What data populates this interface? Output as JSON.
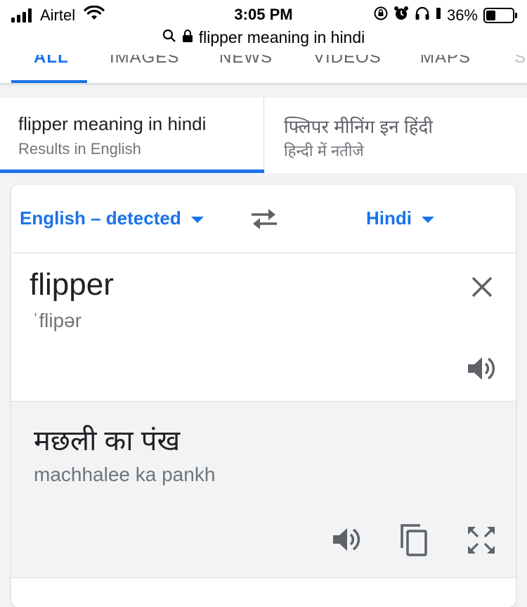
{
  "status_bar": {
    "carrier": "Airtel",
    "time": "3:05 PM",
    "battery_percent": "36%",
    "battery_level": 0.36
  },
  "browser": {
    "url_text": "flipper meaning in hindi"
  },
  "search_tabs": [
    {
      "label": "ALL",
      "active": true
    },
    {
      "label": "IMAGES",
      "active": false
    },
    {
      "label": "NEWS",
      "active": false
    },
    {
      "label": "VIDEOS",
      "active": false
    },
    {
      "label": "MAPS",
      "active": false
    },
    {
      "label": "S",
      "active": false
    }
  ],
  "query_toggle": {
    "english": {
      "query": "flipper meaning in hindi",
      "subtitle": "Results in English"
    },
    "hindi": {
      "query": "फ्लिपर मीनिंग इन हिंदी",
      "subtitle": "हिन्दी में नतीजे"
    }
  },
  "translator": {
    "source_language": "English – detected",
    "target_language": "Hindi",
    "source_text": "flipper",
    "source_phonetic": "ˈflipər",
    "translation": "मछली का पंख",
    "transliteration": "machhalee ka pankh"
  },
  "colors": {
    "accent": "#1a73e8",
    "text_primary": "#202124",
    "text_secondary": "#70757a",
    "icon_gray": "#5f6368",
    "background": "#f1f3f4"
  },
  "icons": {
    "status": [
      "signal-icon",
      "wifi-icon",
      "orientation-lock-icon",
      "alarm-icon",
      "headphones-icon",
      "battery-icon"
    ],
    "url": [
      "search-icon",
      "lock-icon"
    ],
    "translator": [
      "swap-languages-icon",
      "clear-icon",
      "speaker-icon",
      "copy-icon",
      "fullscreen-icon"
    ]
  }
}
